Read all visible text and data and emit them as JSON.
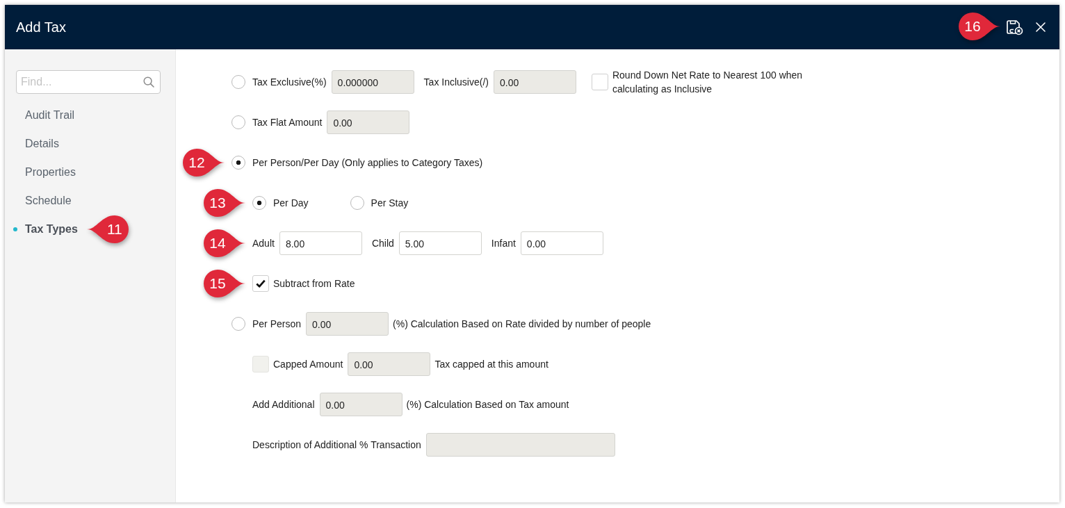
{
  "header": {
    "title": "Add Tax",
    "callout": "16"
  },
  "sidebar": {
    "search": {
      "placeholder": "Find..."
    },
    "items": [
      {
        "label": "Audit Trail",
        "selected": false
      },
      {
        "label": "Details",
        "selected": false
      },
      {
        "label": "Properties",
        "selected": false
      },
      {
        "label": "Schedule",
        "selected": false
      },
      {
        "label": "Tax Types",
        "selected": true,
        "callout": "11"
      }
    ]
  },
  "form": {
    "options": [
      {
        "items": [
          {
            "kind": "radio",
            "label": "Tax Exclusive(%)",
            "selected": false
          },
          {
            "kind": "field",
            "value": "0.000000",
            "disabled": true
          },
          {
            "kind": "label",
            "text": "Tax Inclusive(/)"
          },
          {
            "kind": "field",
            "value": "0.00",
            "disabled": true
          },
          {
            "kind": "checkbox",
            "label": "Round Down Net Rate to Nearest 100 when calculating as Inclusive",
            "checked": false,
            "disabled": false
          }
        ]
      },
      {
        "items": [
          {
            "kind": "radio",
            "label": "Tax Flat Amount",
            "selected": false
          },
          {
            "kind": "field",
            "value": "0.00",
            "disabled": true
          }
        ]
      },
      {
        "callout": "12",
        "items": [
          {
            "kind": "radio",
            "label": "Per Person/Per Day (Only applies to Category Taxes)",
            "selected": true
          }
        ],
        "children": [
          {
            "callout": "13",
            "items": [
              {
                "kind": "radio",
                "label": "Per Day",
                "selected": true
              },
              {
                "kind": "radio",
                "label": "Per Stay",
                "selected": false
              }
            ]
          },
          {
            "callout": "14",
            "items": [
              {
                "kind": "label",
                "text": "Adult"
              },
              {
                "kind": "field",
                "value": "8.00",
                "disabled": false
              },
              {
                "kind": "label",
                "text": "Child"
              },
              {
                "kind": "field",
                "value": "5.00",
                "disabled": false
              },
              {
                "kind": "label",
                "text": "Infant"
              },
              {
                "kind": "field",
                "value": "0.00",
                "disabled": false
              }
            ]
          },
          {
            "callout": "15",
            "items": [
              {
                "kind": "checkbox",
                "label": "Subtract from Rate",
                "checked": true,
                "disabled": false
              }
            ]
          }
        ]
      },
      {
        "items": [
          {
            "kind": "radio",
            "label": "Per Person",
            "selected": false
          },
          {
            "kind": "field",
            "value": "0.00",
            "disabled": true
          },
          {
            "kind": "hint",
            "text": "(%) Calculation Based on Rate divided by number of people"
          }
        ],
        "children": [
          {
            "items": [
              {
                "kind": "checkbox",
                "label": "Capped Amount",
                "checked": false,
                "disabled": true
              },
              {
                "kind": "field",
                "value": "0.00",
                "disabled": true
              },
              {
                "kind": "hint",
                "text": "Tax capped at this amount"
              }
            ]
          },
          {
            "items": [
              {
                "kind": "label",
                "text": "Add Additional"
              },
              {
                "kind": "field",
                "value": "0.00",
                "disabled": true
              },
              {
                "kind": "hint",
                "text": "(%) Calculation Based on Tax amount"
              }
            ]
          },
          {
            "items": [
              {
                "kind": "label",
                "text": "Description of Additional % Transaction"
              },
              {
                "kind": "long-field",
                "disabled": true
              }
            ]
          }
        ]
      }
    ]
  }
}
